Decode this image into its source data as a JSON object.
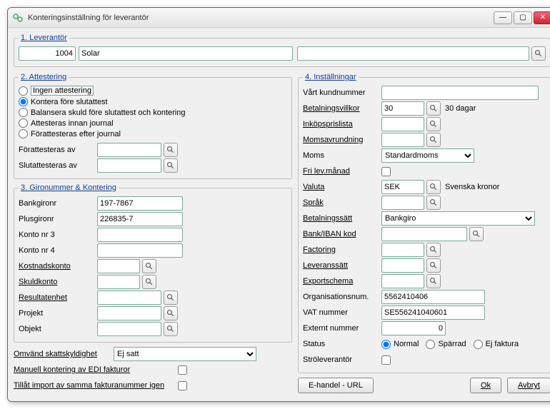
{
  "window": {
    "title": "Konteringsinställning för leverantör"
  },
  "leverantor": {
    "legend_num": "1.",
    "legend_txt": "Leverantör",
    "id": "1004",
    "name": "Solar",
    "extra": ""
  },
  "attestering": {
    "legend_num": "2.",
    "legend_txt": "Attestering",
    "options": {
      "ingen": "Ingen attestering",
      "kontera": "Kontera före slutattest",
      "balansera": "Balansera skuld före slutattest och kontering",
      "innan": "Attesteras innan journal",
      "efter": "Förattesteras efter journal"
    },
    "selected": "kontera",
    "forattesteras_label": "Förattesteras av",
    "slutattesteras_label": "Slutattesteras av",
    "forattesteras_value": "",
    "slutattesteras_value": ""
  },
  "gironummer": {
    "legend_num": "3.",
    "legend_txt": "Gironummer & Kontering",
    "bankgiro_label": "Bankgironr",
    "bankgiro_value": "197-7867",
    "plusgiro_label": "Plusgironr",
    "plusgiro_value": "226835-7",
    "konto3_label": "Konto nr 3",
    "konto3_value": "",
    "konto4_label": "Konto nr 4",
    "konto4_value": "",
    "kostnad_label": "Kostnadskonto",
    "kostnad_value": "",
    "skuld_label": "Skuldkonto",
    "skuld_value": "",
    "resultat_label": "Resultatenhet",
    "resultat_value": "",
    "projekt_label": "Projekt",
    "projekt_value": "",
    "objekt_label": "Objekt",
    "objekt_value": ""
  },
  "extra_left": {
    "omvand_label": "Omvänd skattskyldighet",
    "omvand_value": "Ej satt",
    "manuell_label": "Manuell kontering av EDI fakturor",
    "tillat_label": "Tillåt import av samma fakturanummer igen"
  },
  "installningar": {
    "legend_num": "4.",
    "legend_txt": "Inställningar",
    "kundnr_label": "Vårt kundnummer",
    "kundnr_value": "",
    "betvillkor_label": "Betalningsvillkor",
    "betvillkor_value": "30",
    "betvillkor_desc": "30 dagar",
    "prislista_label": "Inköpsprislista",
    "prislista_value": "",
    "momsavr_label": "Momsavrundning",
    "momsavr_value": "",
    "moms_label": "Moms",
    "moms_value": "Standardmoms",
    "frilev_label": "Fri lev.månad",
    "valuta_label": "Valuta",
    "valuta_value": "SEK",
    "valuta_desc": "Svenska kronor",
    "sprak_label": "Språk",
    "sprak_value": "",
    "betsatt_label": "Betalningssätt",
    "betsatt_value": "Bankgiro",
    "bankiban_label": "Bank/IBAN kod",
    "bankiban_value": "",
    "factoring_label": "Factoring",
    "factoring_value": "",
    "levsatt_label": "Leveranssätt",
    "levsatt_value": "",
    "export_label": "Exportschema",
    "export_value": "",
    "orgnum_label": "Organisationsnum.",
    "orgnum_value": "5562410406",
    "vat_label": "VAT nummer",
    "vat_value": "SE556241040601",
    "extnum_label": "Externt nummer",
    "extnum_value": "0",
    "status_label": "Status",
    "status_options": {
      "normal": "Normal",
      "sparrad": "Spärrad",
      "ejfaktura": "Ej faktura"
    },
    "status_selected": "normal",
    "strolev_label": "Ströleverantör"
  },
  "buttons": {
    "ehandel": "E-handel - URL",
    "ok": "Ok",
    "avbryt": "Avbryt"
  }
}
